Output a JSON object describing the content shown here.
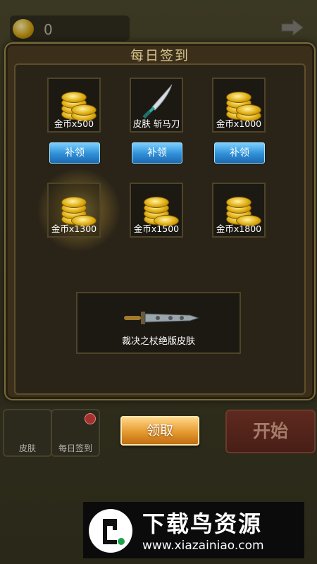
{
  "top": {
    "coin_count": "0"
  },
  "modal": {
    "title": "每日签到",
    "items": [
      {
        "label": "金币x500",
        "type": "coins",
        "button": "补领"
      },
      {
        "label": "皮肤 斩马刀",
        "type": "sword",
        "button": "补领"
      },
      {
        "label": "金币x1000",
        "type": "coins",
        "button": "补领"
      },
      {
        "label": "金币x1300",
        "type": "coins",
        "highlight": true
      },
      {
        "label": "金币x1500",
        "type": "coins"
      },
      {
        "label": "金币x1800",
        "type": "coins"
      }
    ],
    "reward": {
      "label": "裁决之杖绝版皮肤"
    }
  },
  "bottom": {
    "skin_label": "皮肤",
    "checkin_label": "每日签到",
    "claim_label": "领取",
    "start_label": "开始"
  },
  "watermark": {
    "title": "下载鸟资源",
    "url": "www.xiazainiao.com"
  }
}
